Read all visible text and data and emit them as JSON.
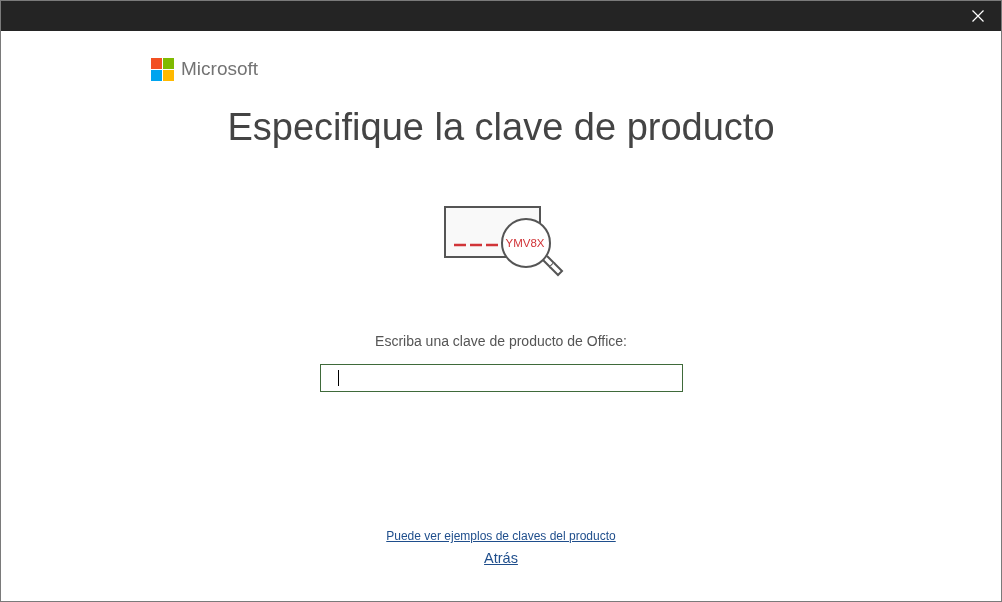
{
  "logo": {
    "text": "Microsoft"
  },
  "heading": "Especifique la clave de producto",
  "illustration": {
    "sample_key": "YMV8X"
  },
  "product_key": {
    "label": "Escriba una clave de producto de Office:",
    "focused": true
  },
  "links": [
    {
      "kind": "help",
      "label": "Puede ver ejemplos de claves del producto"
    },
    {
      "kind": "back",
      "label": "Atrás"
    }
  ]
}
